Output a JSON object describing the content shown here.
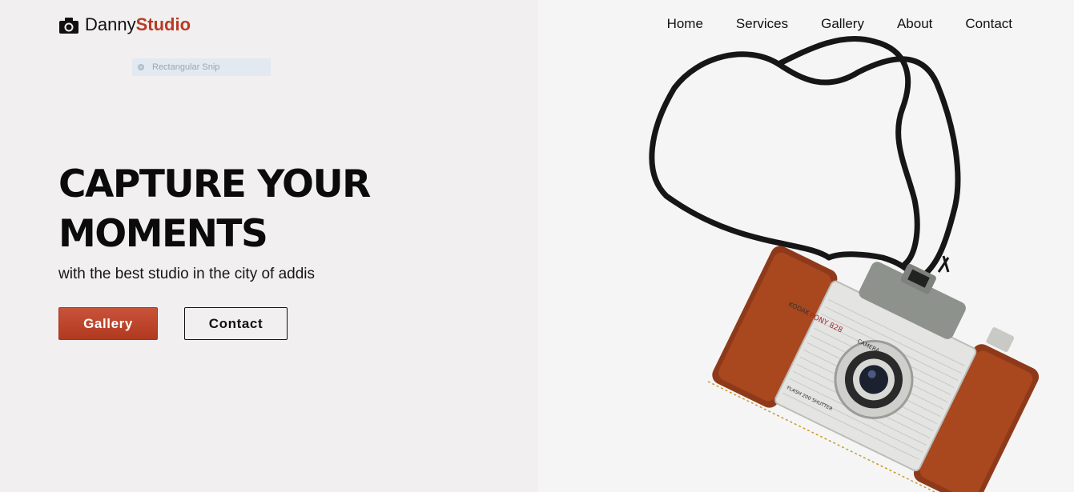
{
  "brand": {
    "name_first": "Danny",
    "name_second": "Studio",
    "accent_color": "#b83a22",
    "icon": "camera-icon"
  },
  "snip_overlay": {
    "label": "Rectangular Snip"
  },
  "nav": {
    "items": [
      {
        "label": "Home"
      },
      {
        "label": "Services"
      },
      {
        "label": "Gallery"
      },
      {
        "label": "About"
      },
      {
        "label": "Contact"
      }
    ]
  },
  "hero": {
    "title_line1": "CAPTURE YOUR",
    "title_line2": "MOMENTS",
    "subtitle": "with the best studio in the city of addis",
    "primary_button": "Gallery",
    "secondary_button": "Contact",
    "primary_color": "#c0452a"
  },
  "hero_image": {
    "description_icon": "vintage-camera-photo",
    "camera_text_brand": "KODAK",
    "camera_text_model": "PONY 828",
    "camera_text_word": "CAMERA",
    "camera_text_flash": "FLASH 200 SHUTTER"
  }
}
